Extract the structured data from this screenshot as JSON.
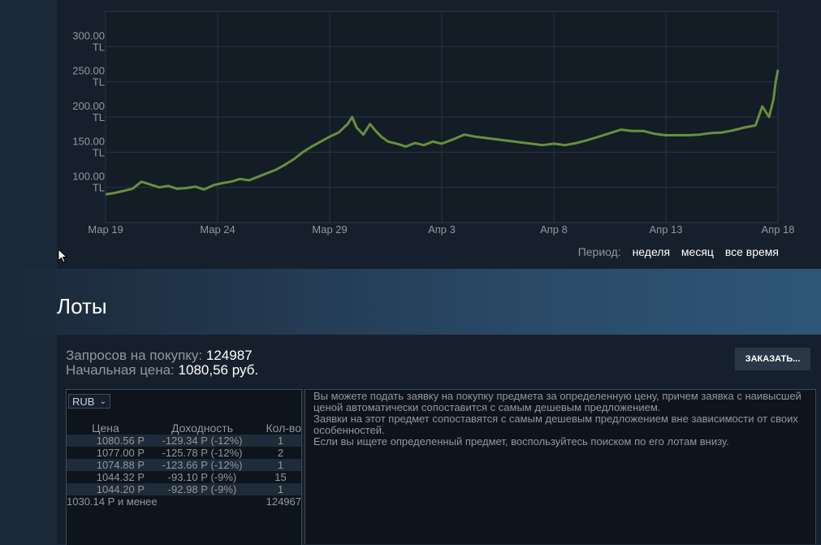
{
  "chart_data": {
    "type": "line",
    "title": "",
    "xlabel": "",
    "ylabel": "",
    "x_tick_labels": [
      "Мар 19",
      "Мар 24",
      "Мар 29",
      "Апр 3",
      "Апр 8",
      "Апр 13",
      "Апр 18"
    ],
    "y_tick_labels": [
      {
        "value": 100,
        "label1": "100.00",
        "label2": "TL"
      },
      {
        "value": 150,
        "label1": "150.00",
        "label2": "TL"
      },
      {
        "value": 200,
        "label1": "200.00",
        "label2": "TL"
      },
      {
        "value": 250,
        "label1": "250.00",
        "label2": "TL"
      },
      {
        "value": 300,
        "label1": "300.00",
        "label2": "TL"
      }
    ],
    "xlim": [
      0,
      30
    ],
    "ylim": [
      50,
      350
    ],
    "grid": true,
    "line_color": "#688f3e",
    "series": [
      {
        "points": [
          [
            0,
            90
          ],
          [
            0.4,
            92
          ],
          [
            0.8,
            95
          ],
          [
            1.2,
            98
          ],
          [
            1.6,
            108
          ],
          [
            2,
            104
          ],
          [
            2.4,
            100
          ],
          [
            2.8,
            102
          ],
          [
            3.2,
            98
          ],
          [
            3.6,
            99
          ],
          [
            4,
            101
          ],
          [
            4.4,
            97
          ],
          [
            4.8,
            103
          ],
          [
            5.2,
            106
          ],
          [
            5.6,
            108
          ],
          [
            6,
            112
          ],
          [
            6.4,
            110
          ],
          [
            6.8,
            115
          ],
          [
            7.2,
            120
          ],
          [
            7.6,
            125
          ],
          [
            8,
            132
          ],
          [
            8.4,
            140
          ],
          [
            8.8,
            150
          ],
          [
            9.2,
            158
          ],
          [
            9.6,
            165
          ],
          [
            10,
            172
          ],
          [
            10.4,
            178
          ],
          [
            10.8,
            190
          ],
          [
            11,
            200
          ],
          [
            11.2,
            185
          ],
          [
            11.5,
            175
          ],
          [
            11.8,
            190
          ],
          [
            12,
            182
          ],
          [
            12.3,
            172
          ],
          [
            12.6,
            165
          ],
          [
            13,
            162
          ],
          [
            13.4,
            158
          ],
          [
            13.8,
            163
          ],
          [
            14.2,
            160
          ],
          [
            14.6,
            165
          ],
          [
            15,
            162
          ],
          [
            15.5,
            168
          ],
          [
            16,
            175
          ],
          [
            16.5,
            172
          ],
          [
            17,
            170
          ],
          [
            17.5,
            168
          ],
          [
            18,
            166
          ],
          [
            18.5,
            164
          ],
          [
            19,
            162
          ],
          [
            19.5,
            160
          ],
          [
            20,
            162
          ],
          [
            20.5,
            160
          ],
          [
            21,
            163
          ],
          [
            21.5,
            167
          ],
          [
            22,
            172
          ],
          [
            22.5,
            177
          ],
          [
            23,
            182
          ],
          [
            23.5,
            180
          ],
          [
            24,
            180
          ],
          [
            24.5,
            176
          ],
          [
            25,
            174
          ],
          [
            25.5,
            174
          ],
          [
            26,
            174
          ],
          [
            26.5,
            175
          ],
          [
            27,
            177
          ],
          [
            27.5,
            178
          ],
          [
            28,
            181
          ],
          [
            28.5,
            185
          ],
          [
            29,
            188
          ],
          [
            29.3,
            215
          ],
          [
            29.6,
            200
          ],
          [
            29.8,
            225
          ],
          [
            29.9,
            250
          ],
          [
            30,
            267
          ]
        ]
      }
    ]
  },
  "period": {
    "label": "Период:",
    "week": "неделя",
    "month": "месяц",
    "all": "все время"
  },
  "lots": {
    "title": "Лоты"
  },
  "orders": {
    "requests_label": "Запросов на покупку:",
    "requests_value": "124987",
    "start_price_label": "Начальная цена:",
    "start_price_value": "1080,56 руб.",
    "order_button": "ЗАКАЗАТЬ..."
  },
  "book": {
    "currency": "RUB",
    "headers": [
      "Цена",
      "Доходность",
      "Кол-во"
    ],
    "rows": [
      [
        "1080.56 Р",
        "-129.34 Р (-12%)",
        "1"
      ],
      [
        "1077.00 Р",
        "-125.78 Р (-12%)",
        "2"
      ],
      [
        "1074.88 Р",
        "-123.66 Р (-12%)",
        "1"
      ],
      [
        "1044.32 Р",
        "-93.10 Р (-9%)",
        "15"
      ],
      [
        "1044.20 Р",
        "-92.98 Р (-9%)",
        "1"
      ]
    ],
    "footer_price": "1030.14 Р и менее",
    "footer_qty": "124967"
  },
  "description": [
    "Вы можете подать заявку на покупку предмета за определенную цену, причем заявка с наивысшей ценой автоматически сопоставится с самым дешевым предложением.",
    "Заявки на этот предмет сопоставятся с самым дешевым предложением вне зависимости от своих особенностей.",
    "Если вы ищете определенный предмет, воспользуйтесь поиском по его лотам внизу."
  ]
}
